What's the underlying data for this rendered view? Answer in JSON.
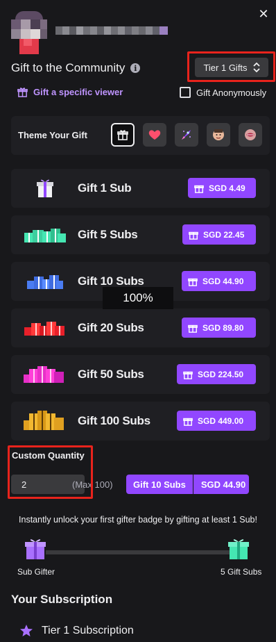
{
  "header": {
    "title": "Gift to the Community",
    "tier_select": "Tier 1 Gifts",
    "specific_viewer": "Gift a specific viewer",
    "anonymous_label": "Gift Anonymously"
  },
  "theme": {
    "label": "Theme Your Gift",
    "options": [
      "gift-icon",
      "heart-icon",
      "rocket-icon",
      "face-emote-icon",
      "lips-emote-icon"
    ]
  },
  "gifts": [
    {
      "label": "Gift 1 Sub",
      "price": "SGD 4.49"
    },
    {
      "label": "Gift 5 Subs",
      "price": "SGD 22.45"
    },
    {
      "label": "Gift 10 Subs",
      "price": "SGD 44.90"
    },
    {
      "label": "Gift 20 Subs",
      "price": "SGD 89.80"
    },
    {
      "label": "Gift 50 Subs",
      "price": "SGD 224.50"
    },
    {
      "label": "Gift 100 Subs",
      "price": "SGD 449.00"
    }
  ],
  "overlay": {
    "zoom": "100%"
  },
  "custom": {
    "label": "Custom Quantity",
    "value": "2",
    "max": "(Max 100)",
    "button_label": "Gift 10 Subs",
    "button_price": "SGD 44.90"
  },
  "badge": {
    "unlock_text": "Instantly unlock your first gifter badge by gifting at least 1 Sub!",
    "left_label": "Sub Gifter",
    "right_label": "5 Gift Subs"
  },
  "subscription": {
    "heading": "Your Subscription",
    "tier": "Tier 1 Subscription"
  },
  "colors": {
    "accent": "#9147ff",
    "link": "#bf94ff",
    "background": "#18181b",
    "card": "#1f1f23",
    "highlight_box": "#e8231c"
  }
}
